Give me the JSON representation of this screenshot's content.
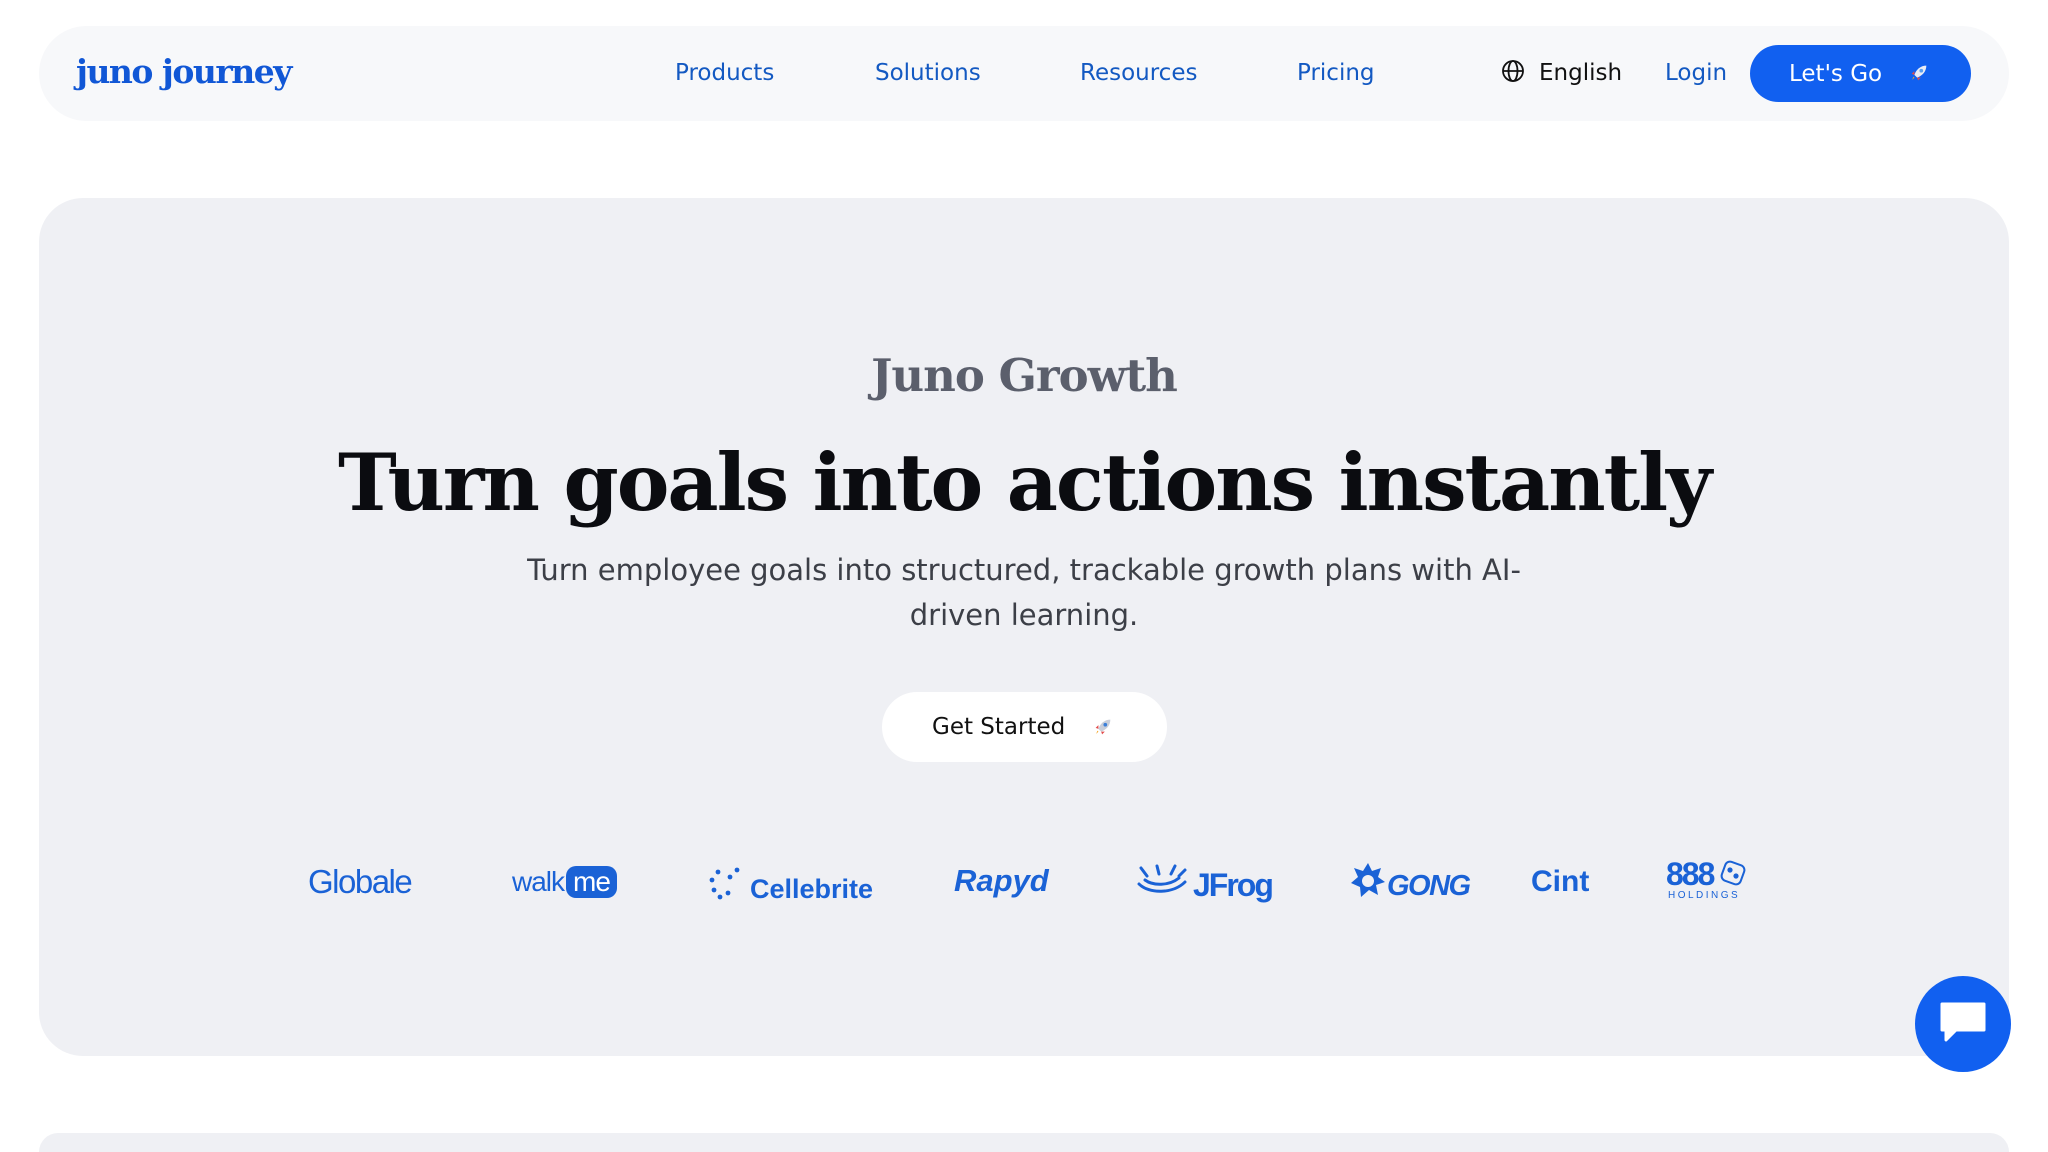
{
  "header": {
    "logo": "juno journey",
    "nav": [
      {
        "label": "Products"
      },
      {
        "label": "Solutions"
      },
      {
        "label": "Resources"
      },
      {
        "label": "Pricing"
      }
    ],
    "language": {
      "label": "English",
      "icon": "globe-icon"
    },
    "login_label": "Login",
    "cta_label": "Let's Go",
    "cta_icon": "rocket-icon"
  },
  "hero": {
    "eyebrow": "Juno Growth",
    "headline": "Turn goals into actions instantly",
    "subhead": "Turn employee goals into structured, trackable growth plans with AI-driven learning.",
    "button_label": "Get Started",
    "button_icon": "rocket-icon"
  },
  "client_logos": {
    "globale": "Global",
    "globale_mark": "e",
    "walkme_walk": "walk",
    "walkme_me": "me",
    "cellebrite": "Cellebrite",
    "rapyd": "Rapyd",
    "jfrog": "JFrog",
    "gong": "GONG",
    "cint": "Cint",
    "holdings_number": "888",
    "holdings_sub": "HOLDINGS"
  },
  "chat": {
    "icon": "chat-bubble-icon"
  },
  "colors": {
    "brand_blue": "#1160f0",
    "link_blue": "#1359c2",
    "logo_blue": "#1a62d6",
    "header_bg": "#f7f8fa",
    "hero_bg": "#eff0f4",
    "headline": "#0b0c10",
    "eyebrow": "#5b5f6c"
  }
}
